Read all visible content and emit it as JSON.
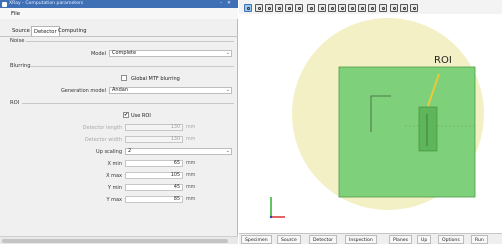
{
  "window": {
    "title": "XRay - Computation parameters"
  },
  "menu": {
    "file": "File"
  },
  "tabs": [
    {
      "label": "Source"
    },
    {
      "label": "Detector"
    },
    {
      "label": "Computing"
    }
  ],
  "noise": {
    "group_label": "Noise",
    "model_label": "Model",
    "model_value": "Complete"
  },
  "blurring": {
    "group_label": "Blurring",
    "global_mtf_label": "Global MTF blurring",
    "global_mtf_checked": false,
    "generation_model_label": "Generation model",
    "generation_model_value": "Andan"
  },
  "roi": {
    "group_label": "ROI",
    "use_roi_label": "Use ROI",
    "use_roi_checked": true,
    "detector_length_label": "Detector length",
    "detector_length_value": "130",
    "detector_length_unit": "mm",
    "detector_width_label": "Detector width",
    "detector_width_value": "130",
    "detector_width_unit": "mm",
    "up_scaling_label": "Up scaling",
    "up_scaling_value": "2",
    "x_min_label": "X min",
    "x_min_value": "65",
    "x_min_unit": "mm",
    "x_max_label": "X max",
    "x_max_value": "105",
    "x_max_unit": "mm",
    "y_min_label": "Y min",
    "y_min_value": "45",
    "y_min_unit": "mm",
    "y_max_label": "Y max",
    "y_max_value": "85",
    "y_max_unit": "mm"
  },
  "toolbar_icons": [
    "select-icon",
    "grid-icon",
    "cube-icon",
    "cube-icon",
    "cube-icon",
    "zoom-icon",
    "camera-icon",
    "camera-icon",
    "rotate-icon",
    "rotate-icon",
    "rotate-icon",
    "rotate-icon",
    "rotate-icon",
    "rotate-icon",
    "view-icon",
    "view-icon",
    "view-icon"
  ],
  "viewport": {
    "roi_annotation": "ROI",
    "colors": {
      "background_disc": "#f4f0c6",
      "detector_fill": "#7fd07a",
      "detector_stroke": "#4a9b45",
      "roi_fill": "#5db65a",
      "arrow": "#e9c93a"
    }
  },
  "bottom_tabs": [
    {
      "label": "Specimen"
    },
    {
      "label": "Source"
    },
    {
      "label": "Detector"
    },
    {
      "label": "Inspection"
    },
    {
      "label": "Planes"
    },
    {
      "label": "Up"
    },
    {
      "label": "Options"
    },
    {
      "label": "Run"
    }
  ]
}
